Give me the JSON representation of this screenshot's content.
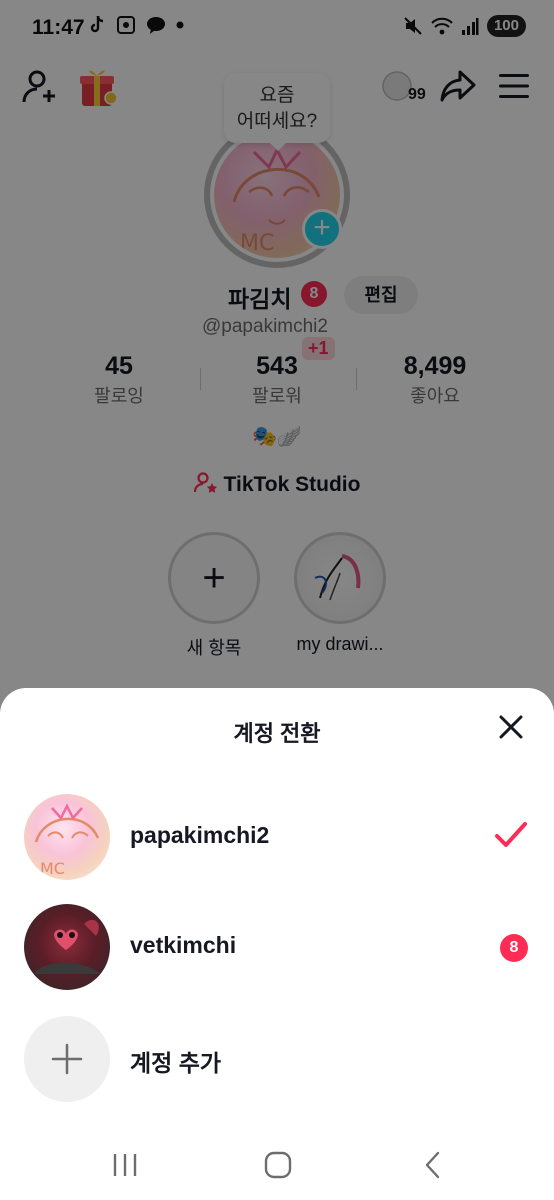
{
  "status_bar": {
    "time": "11:47",
    "battery": "100",
    "icons": [
      "tiktok-icon",
      "screenshot-icon",
      "kakaotalk-icon",
      "dot-icon",
      "mute-icon",
      "wifi-icon",
      "signal-icon"
    ]
  },
  "top_bar": {
    "add_friend_icon": "person-plus-icon",
    "gift_icon": "gift-icon",
    "coin_count": "99",
    "share_icon": "share-icon",
    "menu_icon": "hamburger-menu-icon"
  },
  "profile": {
    "bubble_line1": "요즘",
    "bubble_line2": "어떠세요?",
    "name": "파김치",
    "name_badge": "8",
    "edit_label": "편집",
    "handle": "@papakimchi2",
    "follower_delta": "+1",
    "stats": [
      {
        "value": "45",
        "label": "팔로잉"
      },
      {
        "value": "543",
        "label": "팔로워"
      },
      {
        "value": "8,499",
        "label": "좋아요"
      }
    ],
    "emoji": "🎭🪽",
    "studio_label": "TikTok Studio",
    "highlights": [
      {
        "label": "새 항목"
      },
      {
        "label": "my drawi..."
      }
    ]
  },
  "sheet": {
    "title": "계정 전환",
    "accounts": [
      {
        "username": "papakimchi2",
        "selected": true
      },
      {
        "username": "vetkimchi",
        "badge": "8"
      }
    ],
    "add_account_label": "계정 추가"
  },
  "colors": {
    "accent": "#fe2c55",
    "cyan": "#20d5ec",
    "overlay": "#000000"
  }
}
